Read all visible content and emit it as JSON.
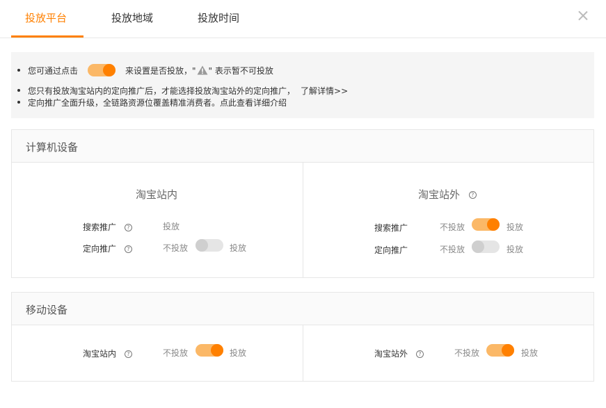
{
  "tabs": [
    {
      "label": "投放平台",
      "active": true
    },
    {
      "label": "投放地域",
      "active": false
    },
    {
      "label": "投放时间",
      "active": false
    }
  ],
  "notice": {
    "line1_before": "您可通过点击",
    "line1_after": "来设置是否投放，\"",
    "line1_end": "\" 表示暂不可投放",
    "line2": "您只有投放淘宝站内的定向推广后，才能选择投放淘宝站外的定向推广，",
    "line2_link": "了解详情>>",
    "line3": "定向推广全面升级，全链路资源位覆盖精准消费者。点此查看详细介绍"
  },
  "computer": {
    "title": "计算机设备",
    "inside": {
      "title": "淘宝站内",
      "rows": [
        {
          "label": "搜索推广",
          "off_text": "",
          "on_text": "投放",
          "toggle": null
        },
        {
          "label": "定向推广",
          "off_text": "不投放",
          "on_text": "投放",
          "toggle": false
        }
      ]
    },
    "outside": {
      "title": "淘宝站外",
      "rows": [
        {
          "label": "搜索推广",
          "off_text": "不投放",
          "on_text": "投放",
          "toggle": true
        },
        {
          "label": "定向推广",
          "off_text": "不投放",
          "on_text": "投放",
          "toggle": false
        }
      ]
    }
  },
  "mobile": {
    "title": "移动设备",
    "inside": {
      "label": "淘宝站内",
      "off_text": "不投放",
      "on_text": "投放",
      "toggle": true
    },
    "outside": {
      "label": "淘宝站外",
      "off_text": "不投放",
      "on_text": "投放",
      "toggle": true
    }
  },
  "colors": {
    "accent": "#ff8000",
    "toggle_on_track": "#fbb867",
    "toggle_off_track": "#e5e5e5"
  },
  "icons": {
    "close": "close-icon",
    "help": "help-icon",
    "warning": "warning-icon"
  }
}
